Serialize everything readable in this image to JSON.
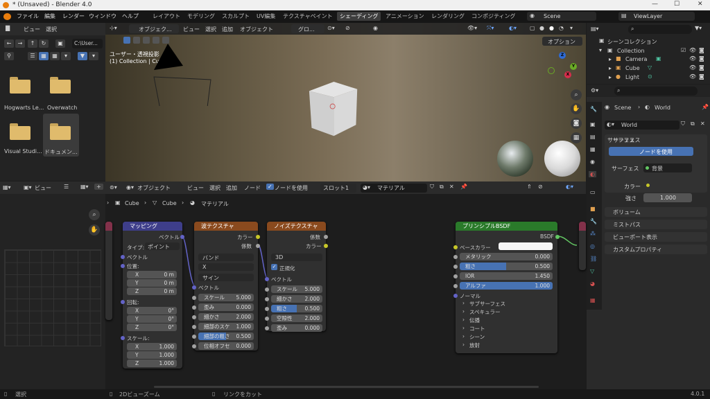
{
  "titlebar": {
    "title": "* (Unsaved) - Blender 4.0"
  },
  "menubar": {
    "menus": [
      "ファイル",
      "編集",
      "レンダー",
      "ウィンドウ",
      "ヘルプ"
    ],
    "workspaces": [
      "レイアウト",
      "モデリング",
      "スカルプト",
      "UV編集",
      "テクスチャペイント",
      "シェーディング",
      "アニメーション",
      "レンダリング",
      "コンポジティング"
    ],
    "active_workspace": "シェーディング",
    "scene": "Scene",
    "view_layer": "ViewLayer"
  },
  "filebrowser": {
    "menus": [
      "ビュー",
      "選択"
    ],
    "path": "C:\\User...",
    "items": [
      "Hogwarts Le...",
      "Overwatch",
      "Visual Studi...",
      "ドキュメン..."
    ]
  },
  "viewport": {
    "mode": "オブジェク...",
    "menus": [
      "ビュー",
      "選択",
      "追加",
      "オブジェクト"
    ],
    "transform": "グロ...",
    "overlay_title": "ユーザー・透視投影",
    "overlay_sub": "(1) Collection | Cube",
    "options": "オプション"
  },
  "outliner": {
    "title": "シーンコレクション",
    "collection": "Collection",
    "items": [
      "Camera",
      "Cube",
      "Light"
    ]
  },
  "properties": {
    "scene": "Scene",
    "world": "World",
    "world_name": "World",
    "surface_panel": "サーフェス",
    "use_nodes": "ノードを使用",
    "surface_label": "サーフェス",
    "surface_value": "背景",
    "color_label": "カラー",
    "strength_label": "強さ",
    "strength_value": "1.000",
    "panels": [
      "ボリューム",
      "ミストパス",
      "ビューポート表示",
      "カスタムプロパティ"
    ]
  },
  "nodeeditor": {
    "view_menu": "ビュー",
    "object_mode": "オブジェクト",
    "menus": [
      "ビュー",
      "選択",
      "追加",
      "ノード"
    ],
    "use_nodes": "ノードを使用",
    "slot": "スロット1",
    "material": "マテリアル",
    "breadcrumb": [
      "Cube",
      "Cube",
      "マテリアル"
    ]
  },
  "node_mapping": {
    "title": "マッピング",
    "out": "ベクトル",
    "type_label": "タイプ:",
    "type_value": "ポイント",
    "vector": "ベクトル",
    "location": "位置:",
    "rotation": "回転:",
    "scale": "スケール:",
    "loc": [
      [
        "X",
        "0 m"
      ],
      [
        "Y",
        "0 m"
      ],
      [
        "Z",
        "0 m"
      ]
    ],
    "rot": [
      [
        "X",
        "0°"
      ],
      [
        "Y",
        "0°"
      ],
      [
        "Z",
        "0°"
      ]
    ],
    "scl": [
      [
        "X",
        "1.000"
      ],
      [
        "Y",
        "1.000"
      ],
      [
        "Z",
        "1.000"
      ]
    ]
  },
  "node_wave": {
    "title": "波テクスチャ",
    "out_color": "カラー",
    "out_fac": "係数",
    "dd1": "バンド",
    "dd2": "X",
    "dd3": "サイン",
    "vector": "ベクトル",
    "fields": [
      [
        "スケール",
        "5.000"
      ],
      [
        "歪み",
        "0.000"
      ],
      [
        "細かさ",
        "2.000"
      ],
      [
        "細部のスケ",
        "1.000"
      ],
      [
        "細部の粗さ",
        "0.500"
      ],
      [
        "位相オフセ",
        "0.000"
      ]
    ]
  },
  "node_noise": {
    "title": "ノイズテクスチャ",
    "out_fac": "係数",
    "out_color": "カラー",
    "dd": "3D",
    "normalize": "正規化",
    "vector": "ベクトル",
    "fields": [
      [
        "スケール",
        "5.000"
      ],
      [
        "細かさ",
        "2.000"
      ],
      [
        "粗さ",
        "0.500"
      ],
      [
        "空隙性",
        "2.000"
      ],
      [
        "歪み",
        "0.000"
      ]
    ]
  },
  "node_bsdf": {
    "title": "プリンシプルBSDF",
    "out": "BSDF",
    "base_color": "ベースカラー",
    "fields": [
      [
        "メタリック",
        "0.000"
      ],
      [
        "粗さ",
        "0.500"
      ],
      [
        "IOR",
        "1.450"
      ],
      [
        "アルファ",
        "1.000"
      ]
    ],
    "normal": "ノーマル",
    "sections": [
      "サブサーフェス",
      "スペキュラー",
      "伝播",
      "コート",
      "シーン",
      "放射"
    ]
  },
  "statusbar": {
    "select": "選択",
    "zoom": "2Dビューズーム",
    "cut": "リンクをカット",
    "version": "4.0.1"
  }
}
